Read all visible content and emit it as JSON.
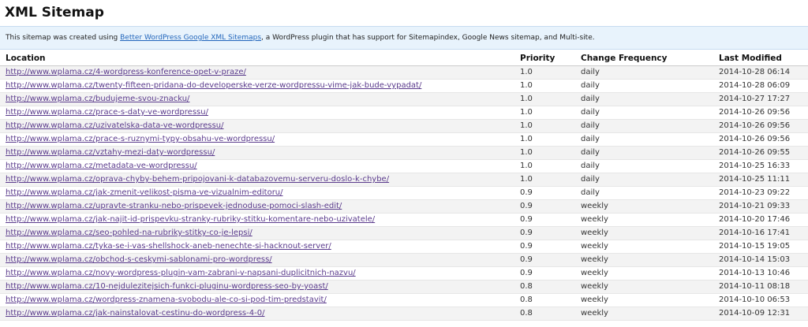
{
  "page": {
    "title": "XML Sitemap"
  },
  "intro": {
    "prefix": "This sitemap was created using ",
    "link_text": "Better WordPress Google XML Sitemaps",
    "suffix": ", a WordPress plugin that has support for Sitemapindex, Google News sitemap, and Multi-site."
  },
  "table": {
    "headers": {
      "location": "Location",
      "priority": "Priority",
      "frequency": "Change Frequency",
      "modified": "Last Modified"
    },
    "rows": [
      {
        "url": "http://www.wplama.cz/4-wordpress-konference-opet-v-praze/",
        "priority": "1.0",
        "freq": "daily",
        "modified": "2014-10-28 06:14"
      },
      {
        "url": "http://www.wplama.cz/twenty-fifteen-pridana-do-developerske-verze-wordpressu-vime-jak-bude-vypadat/",
        "priority": "1.0",
        "freq": "daily",
        "modified": "2014-10-28 06:09"
      },
      {
        "url": "http://www.wplama.cz/budujeme-svou-znacku/",
        "priority": "1.0",
        "freq": "daily",
        "modified": "2014-10-27 17:27"
      },
      {
        "url": "http://www.wplama.cz/prace-s-daty-ve-wordpressu/",
        "priority": "1.0",
        "freq": "daily",
        "modified": "2014-10-26 09:56"
      },
      {
        "url": "http://www.wplama.cz/uzivatelska-data-ve-wordpressu/",
        "priority": "1.0",
        "freq": "daily",
        "modified": "2014-10-26 09:56"
      },
      {
        "url": "http://www.wplama.cz/prace-s-ruznymi-typy-obsahu-ve-wordpressu/",
        "priority": "1.0",
        "freq": "daily",
        "modified": "2014-10-26 09:56"
      },
      {
        "url": "http://www.wplama.cz/vztahy-mezi-daty-wordpressu/",
        "priority": "1.0",
        "freq": "daily",
        "modified": "2014-10-26 09:55"
      },
      {
        "url": "http://www.wplama.cz/metadata-ve-wordpressu/",
        "priority": "1.0",
        "freq": "daily",
        "modified": "2014-10-25 16:33"
      },
      {
        "url": "http://www.wplama.cz/oprava-chyby-behem-pripojovani-k-databazovemu-serveru-doslo-k-chybe/",
        "priority": "1.0",
        "freq": "daily",
        "modified": "2014-10-25 11:11"
      },
      {
        "url": "http://www.wplama.cz/jak-zmenit-velikost-pisma-ve-vizualnim-editoru/",
        "priority": "0.9",
        "freq": "daily",
        "modified": "2014-10-23 09:22"
      },
      {
        "url": "http://www.wplama.cz/upravte-stranku-nebo-prispevek-jednoduse-pomoci-slash-edit/",
        "priority": "0.9",
        "freq": "weekly",
        "modified": "2014-10-21 09:33"
      },
      {
        "url": "http://www.wplama.cz/jak-najit-id-prispevku-stranky-rubriky-stitku-komentare-nebo-uzivatele/",
        "priority": "0.9",
        "freq": "weekly",
        "modified": "2014-10-20 17:46"
      },
      {
        "url": "http://www.wplama.cz/seo-pohled-na-rubriky-stitky-co-je-lepsi/",
        "priority": "0.9",
        "freq": "weekly",
        "modified": "2014-10-16 17:41"
      },
      {
        "url": "http://www.wplama.cz/tyka-se-i-vas-shellshock-aneb-nenechte-si-hacknout-server/",
        "priority": "0.9",
        "freq": "weekly",
        "modified": "2014-10-15 19:05"
      },
      {
        "url": "http://www.wplama.cz/obchod-s-ceskymi-sablonami-pro-wordpress/",
        "priority": "0.9",
        "freq": "weekly",
        "modified": "2014-10-14 15:03"
      },
      {
        "url": "http://www.wplama.cz/novy-wordpress-plugin-vam-zabrani-v-napsani-duplicitnich-nazvu/",
        "priority": "0.9",
        "freq": "weekly",
        "modified": "2014-10-13 10:46"
      },
      {
        "url": "http://www.wplama.cz/10-nejdulezitejsich-funkci-pluginu-wordpress-seo-by-yoast/",
        "priority": "0.8",
        "freq": "weekly",
        "modified": "2014-10-11 08:18"
      },
      {
        "url": "http://www.wplama.cz/wordpress-znamena-svobodu-ale-co-si-pod-tim-predstavit/",
        "priority": "0.8",
        "freq": "weekly",
        "modified": "2014-10-10 06:53"
      },
      {
        "url": "http://www.wplama.cz/jak-nainstalovat-cestinu-do-wordpress-4-0/",
        "priority": "0.8",
        "freq": "weekly",
        "modified": "2014-10-09 12:31"
      }
    ]
  }
}
